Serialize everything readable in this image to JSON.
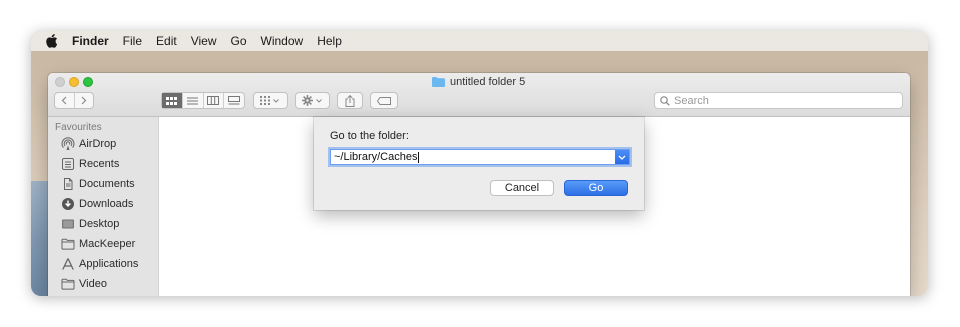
{
  "menubar": {
    "app_name": "Finder",
    "items": [
      "File",
      "Edit",
      "View",
      "Go",
      "Window",
      "Help"
    ]
  },
  "window": {
    "title": "untitled folder 5",
    "search_placeholder": "Search"
  },
  "sidebar": {
    "heading": "Favourites",
    "items": [
      {
        "label": "AirDrop",
        "icon": "airdrop-icon"
      },
      {
        "label": "Recents",
        "icon": "recents-icon"
      },
      {
        "label": "Documents",
        "icon": "documents-icon"
      },
      {
        "label": "Downloads",
        "icon": "downloads-icon"
      },
      {
        "label": "Desktop",
        "icon": "desktop-icon"
      },
      {
        "label": "MacKeeper",
        "icon": "folder-icon"
      },
      {
        "label": "Applications",
        "icon": "applications-icon"
      },
      {
        "label": "Video",
        "icon": "folder-icon"
      }
    ]
  },
  "dialog": {
    "label": "Go to the folder:",
    "path_value": "~/Library/Caches",
    "cancel_label": "Cancel",
    "go_label": "Go"
  },
  "colors": {
    "accent": "#2c6fe6",
    "traffic_yellow": "#f6be30",
    "traffic_green": "#2cc440"
  }
}
